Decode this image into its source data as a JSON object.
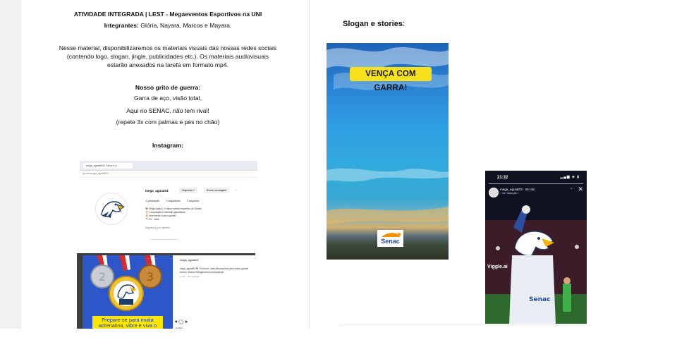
{
  "left": {
    "title": "ATIVIDADE INTEGRADA | LEST - Megaeventos Esportivos na UNI",
    "members_label": "Integrantes:",
    "members_names": " Glória, Nayara, Marcos e Mayara.",
    "intro": "Nesse material, disponibilizaremos os materiais visuais das nossas redes sociais (contendo logo, slogan, jingle, publicidades etc.). Os materiais audiovisuais estarão anexados na tarefa em formato mp4.",
    "war_cry_title": "Nosso grito de guerra:",
    "war_cry_line1": "Garra de aço, visão total,",
    "war_cry_line2": "Aqui no SENAC, não tem rival!",
    "war_cry_line3": "(repete 3x com palmas e pés no chão)",
    "instagram_title": "Instagram:"
  },
  "instagram_profile": {
    "tab": "mega_aguiatt03 • Fotos e ví",
    "address": "ig.com/mega_aguiatt03",
    "username": "mega_aguiat03",
    "following_btn": "Seguindo ˅",
    "message_btn": "Enviar mensagem",
    "more": "···",
    "posts": "1 publicação",
    "followers": "2 seguidores",
    "following": "2 seguindo",
    "bio": [
      "🦅 Mega Águia | O maior evento esportivo do Senac!",
      "🏆 Competição e diversão garantidas",
      "🔥 Vem vencer com a gente!",
      "📍 RJ · mais"
    ],
    "followed_by": "Seguido(a) por: gellarra"
  },
  "instagram_post": {
    "banner": "Prepare-se para muita adrenalina, vibre e viva o",
    "user": "mega_aguiat03",
    "caption": "mega_aguiat03 🦅 Em breve, mais informações sobre nosso grande evento. #senac #Megaeventos #competição",
    "time": "1 sem · Ver tradução",
    "actions": "♥ ◯ ➤",
    "likes": "Curtida"
  },
  "right": {
    "title": "Slogan e stories",
    "title_colon": ":",
    "slogan": "VENÇA COM GARRA!",
    "senac_logo_text": "Senac",
    "phone_time": "21:32",
    "phone_status": "▂▄▆ ◈ ▮",
    "story_user": "mega_aguiat03 · 25 min",
    "story_sub": "♪ Ver tradução ›",
    "story_more": "···",
    "story_close": "✕",
    "watermark": "Viggle.ai"
  },
  "colors": {
    "slogan_bg": "#f7e11d",
    "sky_blue": "#2ea0e3",
    "post_blue": "#2d56c9",
    "banner_yellow": "#ffe600"
  }
}
